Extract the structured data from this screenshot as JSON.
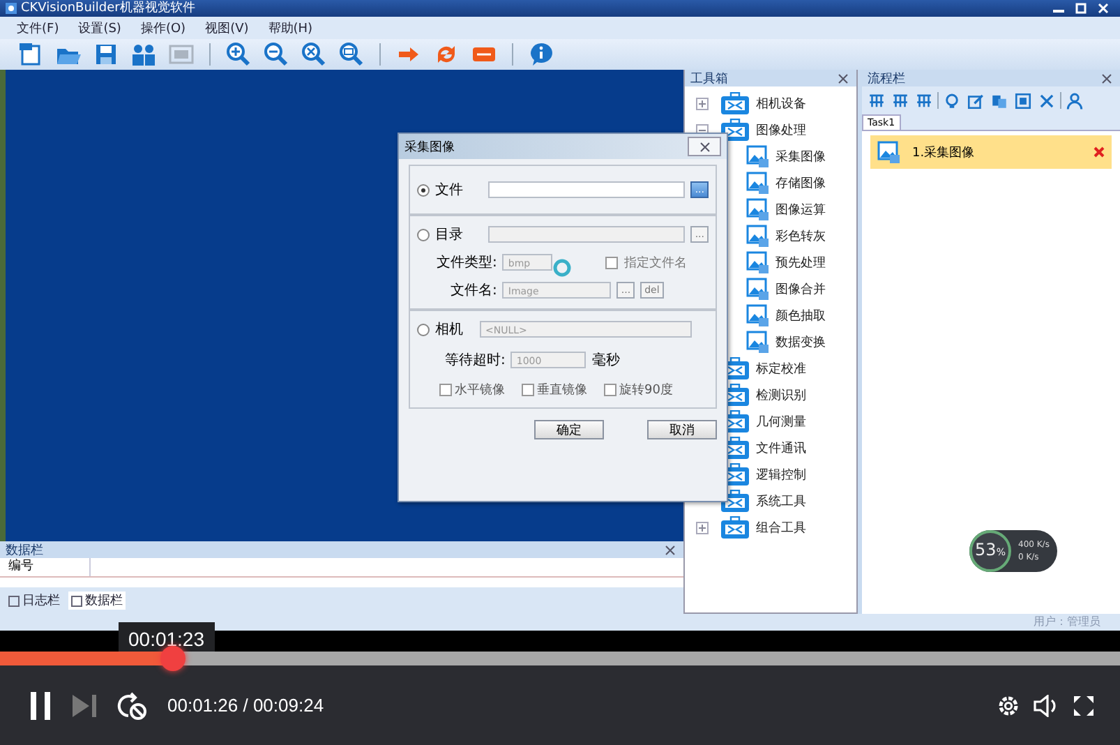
{
  "app_window": {
    "title": "CKVisionBuilder机器视觉软件",
    "menu": [
      "文件(F)",
      "设置(S)",
      "操作(O)",
      "视图(V)",
      "帮助(H)"
    ],
    "toolbar_groups": [
      {
        "buttons": [
          {
            "kind": "new",
            "disabled": false
          },
          {
            "kind": "open",
            "disabled": false
          },
          {
            "kind": "save",
            "disabled": false
          },
          {
            "kind": "users",
            "disabled": false
          },
          {
            "kind": "window",
            "disabled": true
          }
        ]
      },
      {
        "buttons": [
          {
            "kind": "zoom-in",
            "disabled": false
          },
          {
            "kind": "zoom-out",
            "disabled": false
          },
          {
            "kind": "zoom-fit",
            "disabled": false
          },
          {
            "kind": "zoom-actual",
            "disabled": false
          }
        ]
      },
      {
        "buttons": [
          {
            "kind": "run",
            "disabled": false
          },
          {
            "kind": "loop",
            "disabled": false
          },
          {
            "kind": "stop",
            "disabled": false
          }
        ]
      },
      {
        "buttons": [
          {
            "kind": "info",
            "disabled": false
          }
        ]
      }
    ]
  },
  "toolbox": {
    "title": "工具箱",
    "items": [
      {
        "label": "相机设备",
        "expanded": false
      },
      {
        "label": "图像处理",
        "expanded": true,
        "children": [
          {
            "label": "采集图像"
          },
          {
            "label": "存储图像"
          },
          {
            "label": "图像运算"
          },
          {
            "label": "彩色转灰"
          },
          {
            "label": "预先处理"
          },
          {
            "label": "图像合并"
          },
          {
            "label": "颜色抽取"
          },
          {
            "label": "数据变换"
          }
        ]
      },
      {
        "label": "标定校准"
      },
      {
        "label": "检测识别"
      },
      {
        "label": "几何测量"
      },
      {
        "label": "文件通讯"
      },
      {
        "label": "逻辑控制"
      },
      {
        "label": "系统工具"
      },
      {
        "label": "组合工具",
        "expanded": false
      }
    ]
  },
  "flow_panel": {
    "title": "流程栏",
    "toolbar_groups": [
      {
        "buttons": [
          {
            "kind": "add"
          },
          {
            "kind": "add"
          },
          {
            "kind": "add"
          }
        ]
      },
      {
        "buttons": [
          {
            "kind": "view"
          },
          {
            "kind": "edit"
          },
          {
            "kind": "copy"
          },
          {
            "kind": "paste"
          },
          {
            "kind": "delete"
          }
        ]
      },
      {
        "buttons": [
          {
            "kind": "user"
          }
        ]
      }
    ],
    "tabs": [
      {
        "label": "Task1",
        "selected": true
      }
    ],
    "steps": [
      {
        "label": "1.采集图像",
        "selected": true
      }
    ]
  },
  "data_panel": {
    "title": "数据栏",
    "columns": [
      "编号"
    ],
    "tabs": [
      {
        "label": "日志栏",
        "selected": false
      },
      {
        "label": "数据栏",
        "selected": true
      }
    ]
  },
  "status_bar": {
    "user": "用户：管理员"
  },
  "dialog": {
    "title": "采集图像",
    "sections": [
      {
        "kind": "file",
        "label": "文件",
        "selected": true,
        "browse": "..."
      },
      {
        "kind": "directory",
        "label": "目录",
        "selected": false,
        "browse": "...",
        "file_type": {
          "label": "文件类型:",
          "value": "bmp"
        },
        "specify_name": {
          "label": "指定文件名",
          "checked": false
        },
        "file_name": {
          "label": "文件名:",
          "value": "Image",
          "browse": "...",
          "delete": "del"
        }
      },
      {
        "kind": "camera",
        "label": "相机",
        "selected": false,
        "device": "<NULL>",
        "timeout": {
          "label": "等待超时:",
          "value": "1000",
          "unit": "毫秒"
        },
        "options": [
          {
            "label": "水平镜像",
            "checked": false
          },
          {
            "label": "垂直镜像",
            "checked": false
          },
          {
            "label": "旋转90度",
            "checked": false
          }
        ]
      }
    ],
    "buttons": [
      "确定",
      "取消"
    ]
  },
  "net_widget": {
    "percent": "53",
    "unit": "%",
    "upload": "400 K/s",
    "download": "0 K/s"
  },
  "player": {
    "level": 0.154,
    "tooltip": "00:01:23",
    "playing": true,
    "time": "00:01:26 / 00:09:24"
  }
}
